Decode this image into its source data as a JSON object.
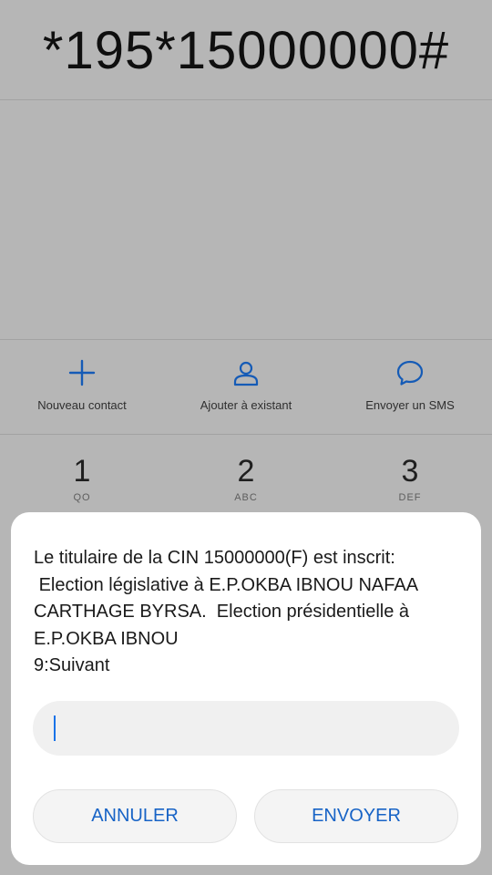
{
  "dialer": {
    "number": "*195*15000000#"
  },
  "actions": [
    {
      "label": "Nouveau contact",
      "icon": "plus-icon"
    },
    {
      "label": "Ajouter à existant",
      "icon": "person-icon"
    },
    {
      "label": "Envoyer un SMS",
      "icon": "chat-bubble-icon"
    }
  ],
  "keypad": [
    {
      "digit": "1",
      "letters": "QO"
    },
    {
      "digit": "2",
      "letters": "ABC"
    },
    {
      "digit": "3",
      "letters": "DEF"
    }
  ],
  "dialog": {
    "message": "Le titulaire de la CIN 15000000(F) est inscrit:\n Election législative à E.P.OKBA IBNOU NAFAA CARTHAGE BYRSA.  Election présidentielle à E.P.OKBA IBNOU\n9:Suivant",
    "input_value": "",
    "cancel_label": "ANNULER",
    "send_label": "ENVOYER"
  },
  "colors": {
    "accent": "#1763c6",
    "background": "#c6c6c6",
    "dialog": "#ffffff"
  }
}
